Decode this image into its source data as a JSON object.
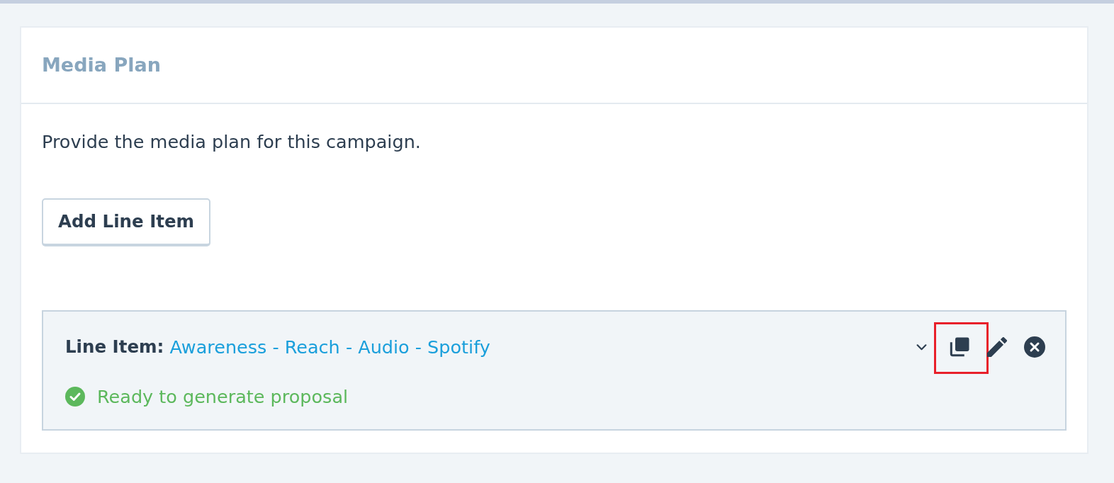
{
  "card": {
    "title": "Media Plan",
    "description": "Provide the media plan for this campaign.",
    "add_button": "Add Line Item"
  },
  "line_items": [
    {
      "label": "Line Item:",
      "name": "Awareness - Reach - Audio - Spotify",
      "status": {
        "kind": "ready",
        "text": "Ready to generate proposal"
      },
      "actions": [
        {
          "kind": "expand",
          "highlighted": false
        },
        {
          "kind": "duplicate",
          "highlighted": true
        },
        {
          "kind": "edit",
          "highlighted": false
        },
        {
          "kind": "remove",
          "highlighted": false
        }
      ]
    }
  ]
}
